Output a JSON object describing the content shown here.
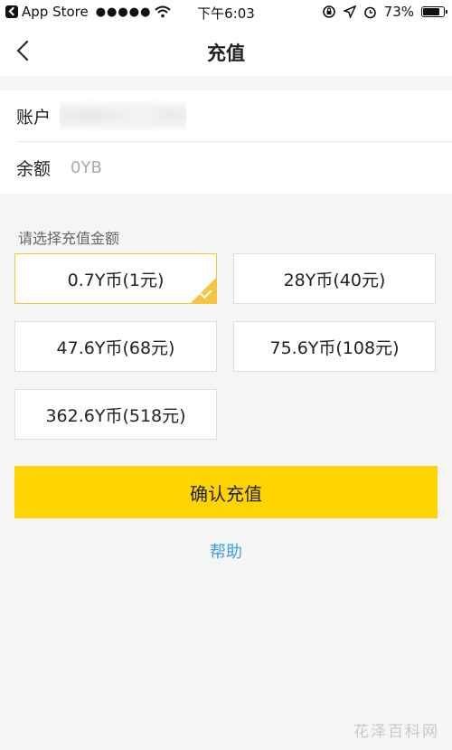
{
  "status_bar": {
    "back_app": "App Store",
    "signal": "●●●●●",
    "time": "下午6:03",
    "battery_percent": "73%",
    "battery_level": 0.73,
    "icons": [
      "wifi-icon",
      "orientation-lock-icon",
      "location-icon",
      "alarm-icon",
      "battery-icon"
    ]
  },
  "nav": {
    "title": "充值"
  },
  "account": {
    "account_label": "账户",
    "balance_label": "余额",
    "balance_value": "0YB"
  },
  "select_label": "请选择充值金额",
  "options": [
    {
      "label": "0.7Y币(1元)",
      "selected": true
    },
    {
      "label": "28Y币(40元)",
      "selected": false
    },
    {
      "label": "47.6Y币(68元)",
      "selected": false
    },
    {
      "label": "75.6Y币(108元)",
      "selected": false
    },
    {
      "label": "362.6Y币(518元)",
      "selected": false
    }
  ],
  "confirm_button": "确认充值",
  "help_link": "帮助",
  "watermark": "花泽百科网",
  "colors": {
    "accent": "#ffd400",
    "selected_border": "#f5c542",
    "link": "#3aa0e6"
  }
}
